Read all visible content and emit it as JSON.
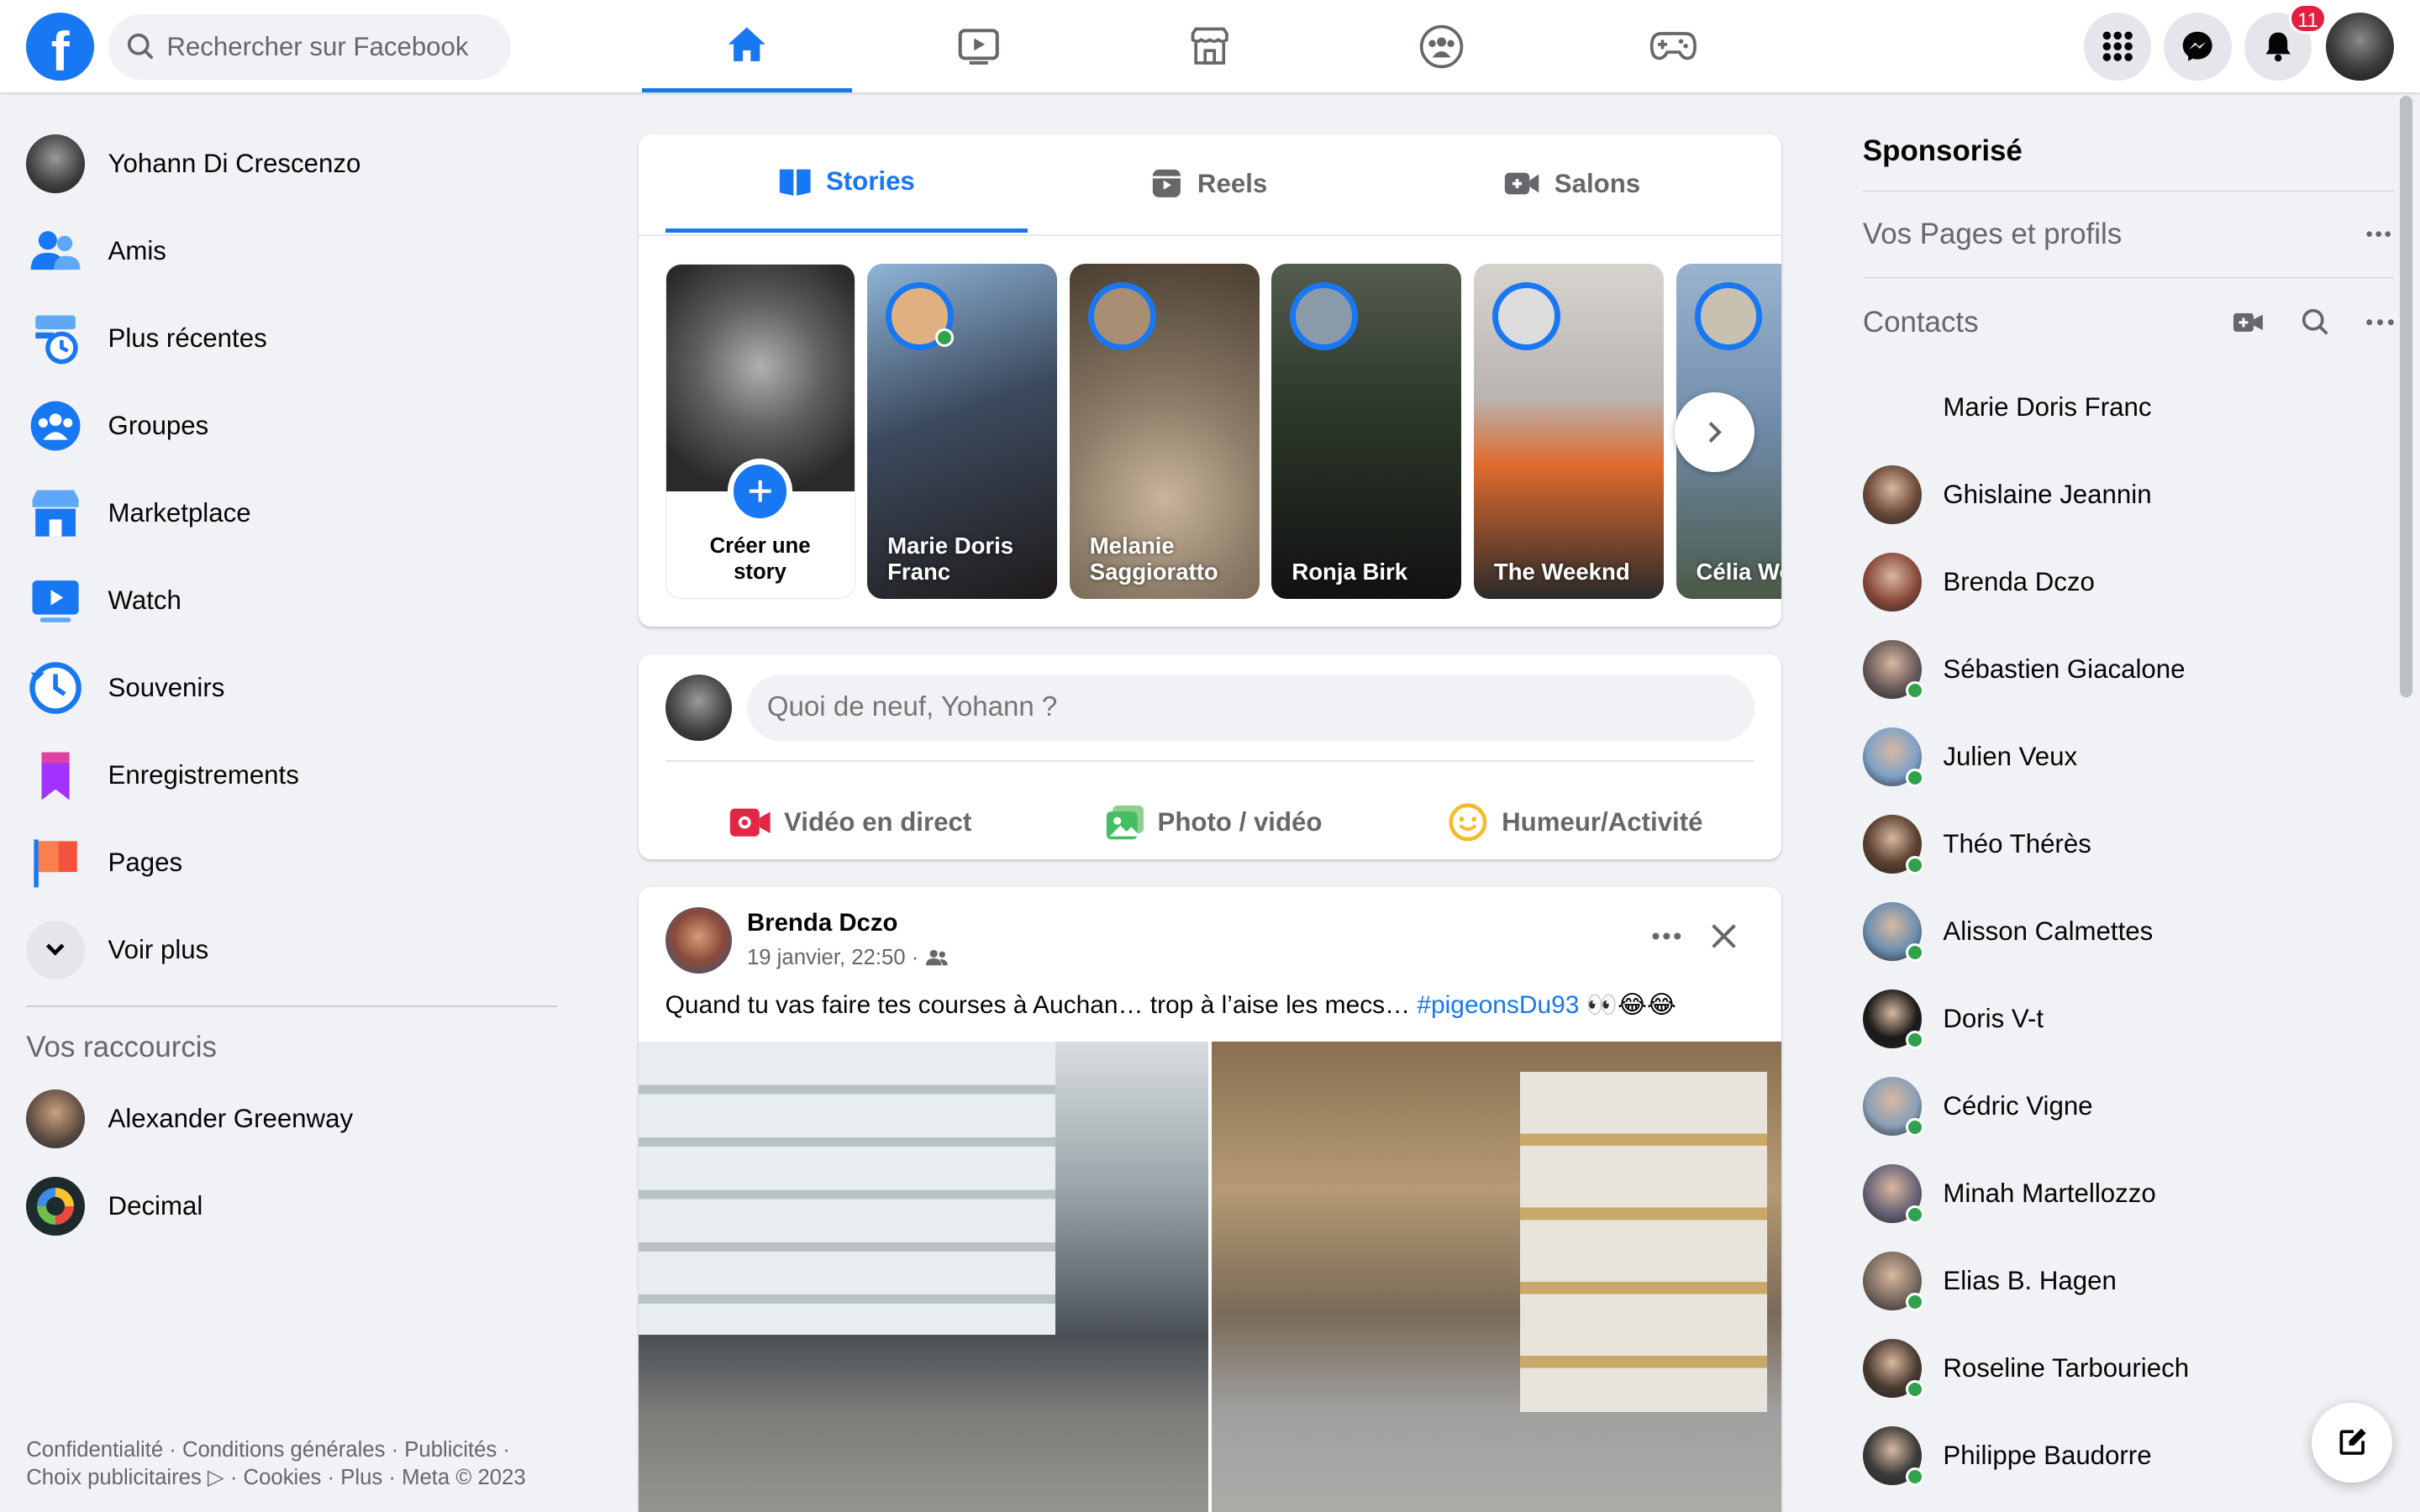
{
  "topbar": {
    "search_placeholder": "Rechercher sur Facebook",
    "notification_count": "11",
    "nav_tabs": [
      "home-icon",
      "watch-icon",
      "marketplace-icon",
      "groups-icon",
      "gaming-icon"
    ],
    "brand_color": "#1877f2"
  },
  "sidebar": {
    "items": [
      {
        "label": "Yohann Di Crescenzo",
        "icon": "profile-avatar"
      },
      {
        "label": "Amis",
        "icon": "friends-icon"
      },
      {
        "label": "Plus récentes",
        "icon": "recent-icon"
      },
      {
        "label": "Groupes",
        "icon": "groups-icon"
      },
      {
        "label": "Marketplace",
        "icon": "marketplace-icon"
      },
      {
        "label": "Watch",
        "icon": "watch-icon"
      },
      {
        "label": "Souvenirs",
        "icon": "memories-icon"
      },
      {
        "label": "Enregistrements",
        "icon": "saved-icon"
      },
      {
        "label": "Pages",
        "icon": "pages-icon"
      },
      {
        "label": "Voir plus",
        "icon": "chevron-down-icon"
      }
    ],
    "shortcuts_title": "Vos raccourcis",
    "shortcuts": [
      {
        "label": "Alexander Greenway"
      },
      {
        "label": "Decimal"
      }
    ],
    "footer": "Confidentialité · Conditions générales · Publicités · Choix publicitaires ▷ · Cookies · Plus · Meta © 2023"
  },
  "stories": {
    "tabs": [
      "Stories",
      "Reels",
      "Salons"
    ],
    "create_label": "Créer une story",
    "items": [
      {
        "name": "Marie Doris Franc",
        "color": "#3c4a5e"
      },
      {
        "name": "Melanie Saggioratto",
        "color": "#8a7a66"
      },
      {
        "name": "Ronja Birk",
        "color": "#2f3a2c"
      },
      {
        "name": "The Weeknd",
        "color": "#b8b4b0"
      },
      {
        "name": "Célia Wolfsba",
        "color": "#6f8aa8"
      }
    ]
  },
  "composer": {
    "placeholder": "Quoi de neuf, Yohann ?",
    "actions": [
      "Vidéo en direct",
      "Photo / vidéo",
      "Humeur/Activité"
    ]
  },
  "post": {
    "author": "Brenda Dczo",
    "timestamp": "19 janvier, 22:50 ·",
    "text": "Quand tu vas faire tes courses à Auchan… trop à l’aise les mecs… ",
    "hashtag": "#pigeonsDu93",
    "emoji": "👀😂😂"
  },
  "rightcol": {
    "sponsored": "Sponsorisé",
    "pages_title": "Vos Pages et profils",
    "contacts_title": "Contacts",
    "contacts": [
      {
        "name": "Marie Doris Franc",
        "online": false,
        "noavatar": true
      },
      {
        "name": "Ghislaine Jeannin",
        "online": false
      },
      {
        "name": "Brenda Dczo",
        "online": false
      },
      {
        "name": "Sébastien Giacalone",
        "online": true
      },
      {
        "name": "Julien Veux",
        "online": true
      },
      {
        "name": "Théo Thérès",
        "online": true
      },
      {
        "name": "Alisson Calmettes",
        "online": true
      },
      {
        "name": "Doris V-t",
        "online": true
      },
      {
        "name": "Cédric Vigne",
        "online": true
      },
      {
        "name": "Minah Martellozzo",
        "online": true
      },
      {
        "name": "Elias B. Hagen",
        "online": true
      },
      {
        "name": "Roseline Tarbouriech",
        "online": true
      },
      {
        "name": "Philippe Baudorre",
        "online": true
      }
    ]
  }
}
